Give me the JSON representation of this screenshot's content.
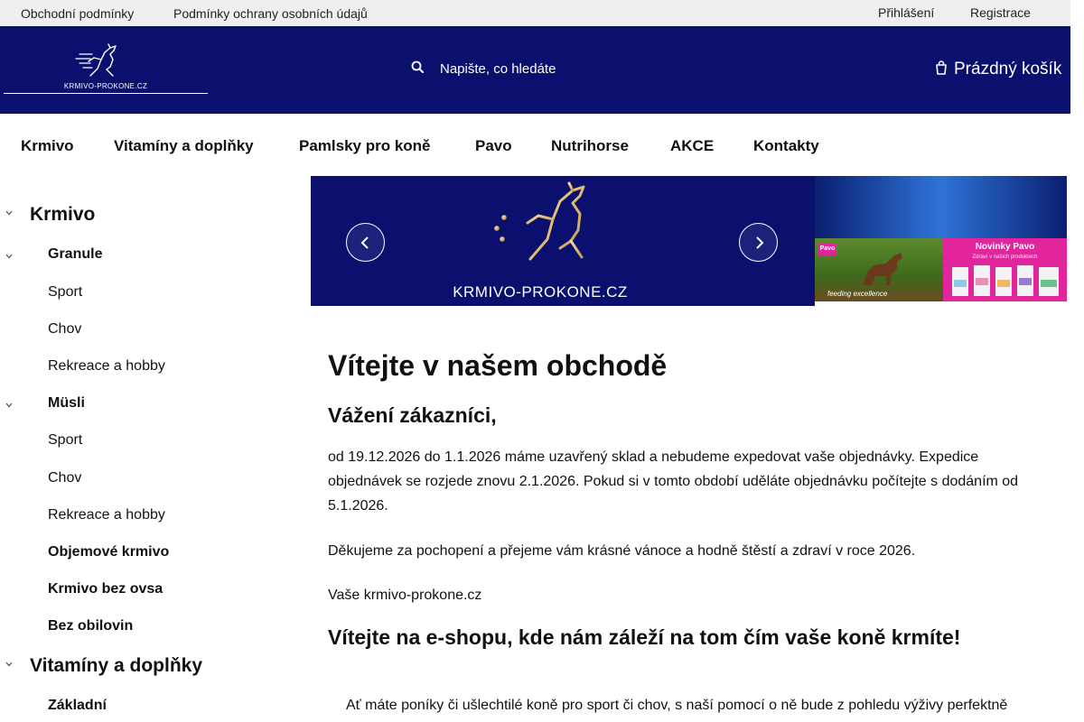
{
  "topbar": {
    "terms": "Obchodní podmínky",
    "privacy": "Podmínky ochrany osobních údajů",
    "login": "Přihlášení",
    "register": "Registrace"
  },
  "header": {
    "logo_text": "KRMIVO-PROKONE.CZ",
    "search_placeholder": "Napište, co hledáte",
    "cart_label": "Prázdný košík",
    "brand_color": "#0b0f6e"
  },
  "nav": {
    "items": [
      "Krmivo",
      "Vitamíny a doplňky",
      "Pamlsky pro koně",
      "Pavo",
      "Nutrihorse",
      "AKCE",
      "Kontakty"
    ]
  },
  "sidebar": {
    "categories": [
      {
        "label": "Krmivo"
      },
      {
        "label": "Granule"
      },
      {
        "label": "Sport"
      },
      {
        "label": "Chov"
      },
      {
        "label": "Rekreace a hobby"
      },
      {
        "label": "Müsli"
      },
      {
        "label": "Sport"
      },
      {
        "label": "Chov"
      },
      {
        "label": "Rekreace a hobby"
      },
      {
        "label": "Objemové krmivo"
      },
      {
        "label": "Krmivo bez ovsa"
      },
      {
        "label": "Bez obilovin"
      },
      {
        "label": "Vitamíny a doplňky"
      },
      {
        "label": "Základní"
      }
    ]
  },
  "banner": {
    "text": "KRMIVO-PROKONE.CZ"
  },
  "promo": {
    "badge": "Pavo",
    "caption": "feeding excellence",
    "title": "Novinky Pavo",
    "subtitle": "Zdraví v našich produktech"
  },
  "content": {
    "title": "Vítejte v našem obchodě",
    "greeting": "Vážení zákazníci,",
    "paragraph1": "od 19.12.2026 do 1.1.2026 máme uzavřený sklad a nebudeme expedovat vaše objednávky. Expedice objednávek se rozjede znovu 2.1.2026. Pokud si v tomto období uděláte objednávku počítejte s dodáním od 5.1.2026.",
    "paragraph2": "Děkujeme za pochopení a přejeme vám krásné vánoce a hodně štěstí a zdraví v roce 2026.",
    "signature": "Vaše krmivo-prokone.cz",
    "subtitle": "Vítejte na e-shopu, kde nám záleží na tom čím vaše koně krmíte!",
    "paragraph3": "Ať máte poníky či ušlechtilé koně pro sport či chov, s naší pomocí o ně bude z pohledu výživy perfektně"
  }
}
